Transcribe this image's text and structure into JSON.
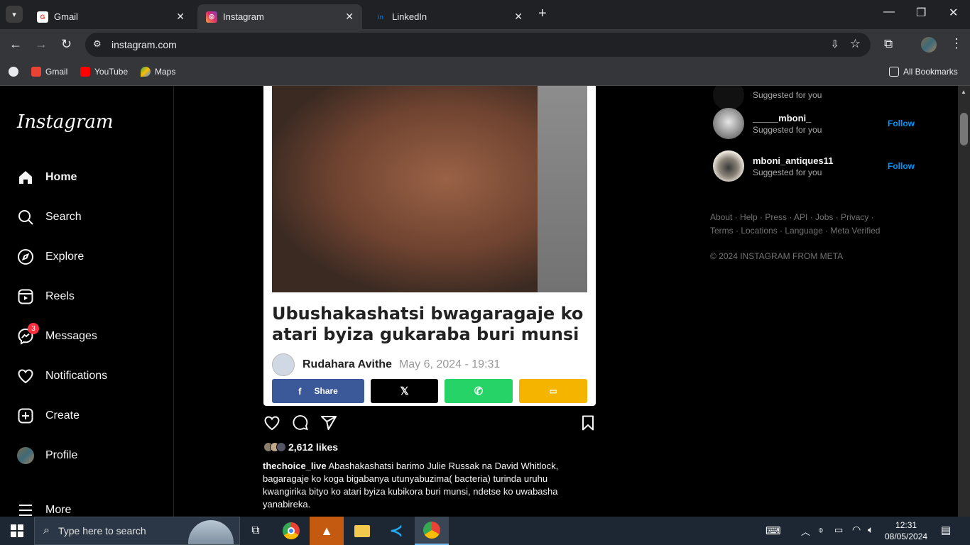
{
  "browser": {
    "tabs": [
      {
        "title": "Gmail",
        "active": false
      },
      {
        "title": "Instagram",
        "active": true
      },
      {
        "title": "LinkedIn",
        "active": false
      }
    ],
    "url": "instagram.com",
    "bookmarks": [
      {
        "label": "Gmail"
      },
      {
        "label": "YouTube"
      },
      {
        "label": "Maps"
      }
    ],
    "all_bookmarks": "All Bookmarks"
  },
  "sidebar": {
    "logo": "Instagram",
    "items": [
      {
        "label": "Home",
        "icon": "home-icon"
      },
      {
        "label": "Search",
        "icon": "search-icon"
      },
      {
        "label": "Explore",
        "icon": "compass-icon"
      },
      {
        "label": "Reels",
        "icon": "reels-icon"
      },
      {
        "label": "Messages",
        "icon": "messenger-icon",
        "badge": "3"
      },
      {
        "label": "Notifications",
        "icon": "heart-icon"
      },
      {
        "label": "Create",
        "icon": "plus-square-icon"
      },
      {
        "label": "Profile",
        "icon": "avatar"
      },
      {
        "label": "More",
        "icon": "menu-icon"
      }
    ]
  },
  "post": {
    "headline": "Ubushakashatsi bwagaragaje ko atari byiza gukaraba buri munsi",
    "author": "Rudahara Avithe",
    "date": "May 6, 2024 - 19:31",
    "share_buttons": [
      {
        "label": "Share",
        "network": "facebook",
        "color": "#3b5998"
      },
      {
        "label": "",
        "network": "x",
        "color": "#000000"
      },
      {
        "label": "",
        "network": "whatsapp",
        "color": "#25d366"
      },
      {
        "label": "",
        "network": "sms",
        "color": "#f5b400"
      }
    ],
    "likes": "2,612 likes",
    "caption_user": "thechoice_live",
    "caption_text": "Abashakashatsi barimo Julie Russak na David Whitlock, bagaragaje ko koga bigabanya utunyabuzima( bacteria) turinda uruhu kwangirika bityo ko atari byiza kubikora buri munsi, ndetse ko uwabasha yanabireka."
  },
  "suggestions": {
    "partial_sub": "Suggested for you",
    "items": [
      {
        "username": "_____mboni_",
        "sub": "Suggested for you",
        "action": "Follow"
      },
      {
        "username": "mboni_antiques11",
        "sub": "Suggested for you",
        "action": "Follow"
      }
    ]
  },
  "footer": {
    "links": "About · Help · Press · API · Jobs · Privacy · Terms · Locations · Language · Meta Verified",
    "copyright": "© 2024 INSTAGRAM FROM META"
  },
  "taskbar": {
    "search_placeholder": "Type here to search",
    "time": "12:31",
    "date": "08/05/2024"
  },
  "colors": {
    "instagram_bg": "#000000",
    "follow_blue": "#0095f6",
    "badge_red": "#ff3040"
  }
}
